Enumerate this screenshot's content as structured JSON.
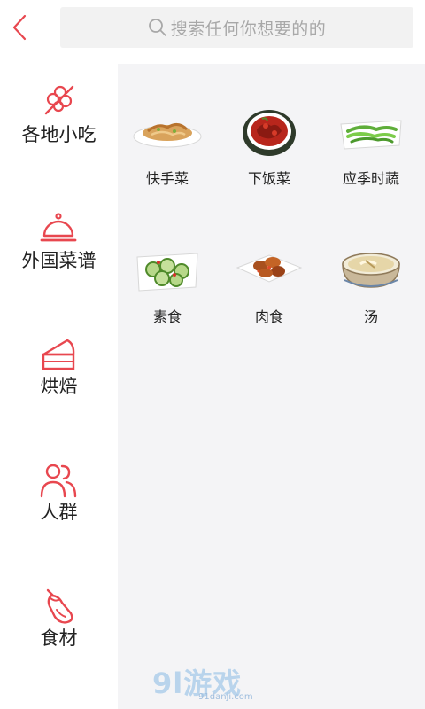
{
  "header": {
    "search_placeholder": "搜索任何你想要的的"
  },
  "sidebar": {
    "items": [
      {
        "label": "各地小吃",
        "icon": "skewer-icon"
      },
      {
        "label": "外国菜谱",
        "icon": "cloche-icon"
      },
      {
        "label": "烘焙",
        "icon": "cake-icon"
      },
      {
        "label": "人群",
        "icon": "people-icon"
      },
      {
        "label": "食材",
        "icon": "eggplant-icon"
      }
    ]
  },
  "categories": [
    {
      "label": "快手菜"
    },
    {
      "label": "下饭菜"
    },
    {
      "label": "应季时蔬"
    },
    {
      "label": "素食"
    },
    {
      "label": "肉食"
    },
    {
      "label": "汤"
    }
  ],
  "watermark": {
    "main": "9l游戏",
    "sub": "91danji.com"
  },
  "colors": {
    "accent": "#e8474f",
    "panel": "#f4f4f6",
    "search_bg": "#f2f2f2"
  }
}
